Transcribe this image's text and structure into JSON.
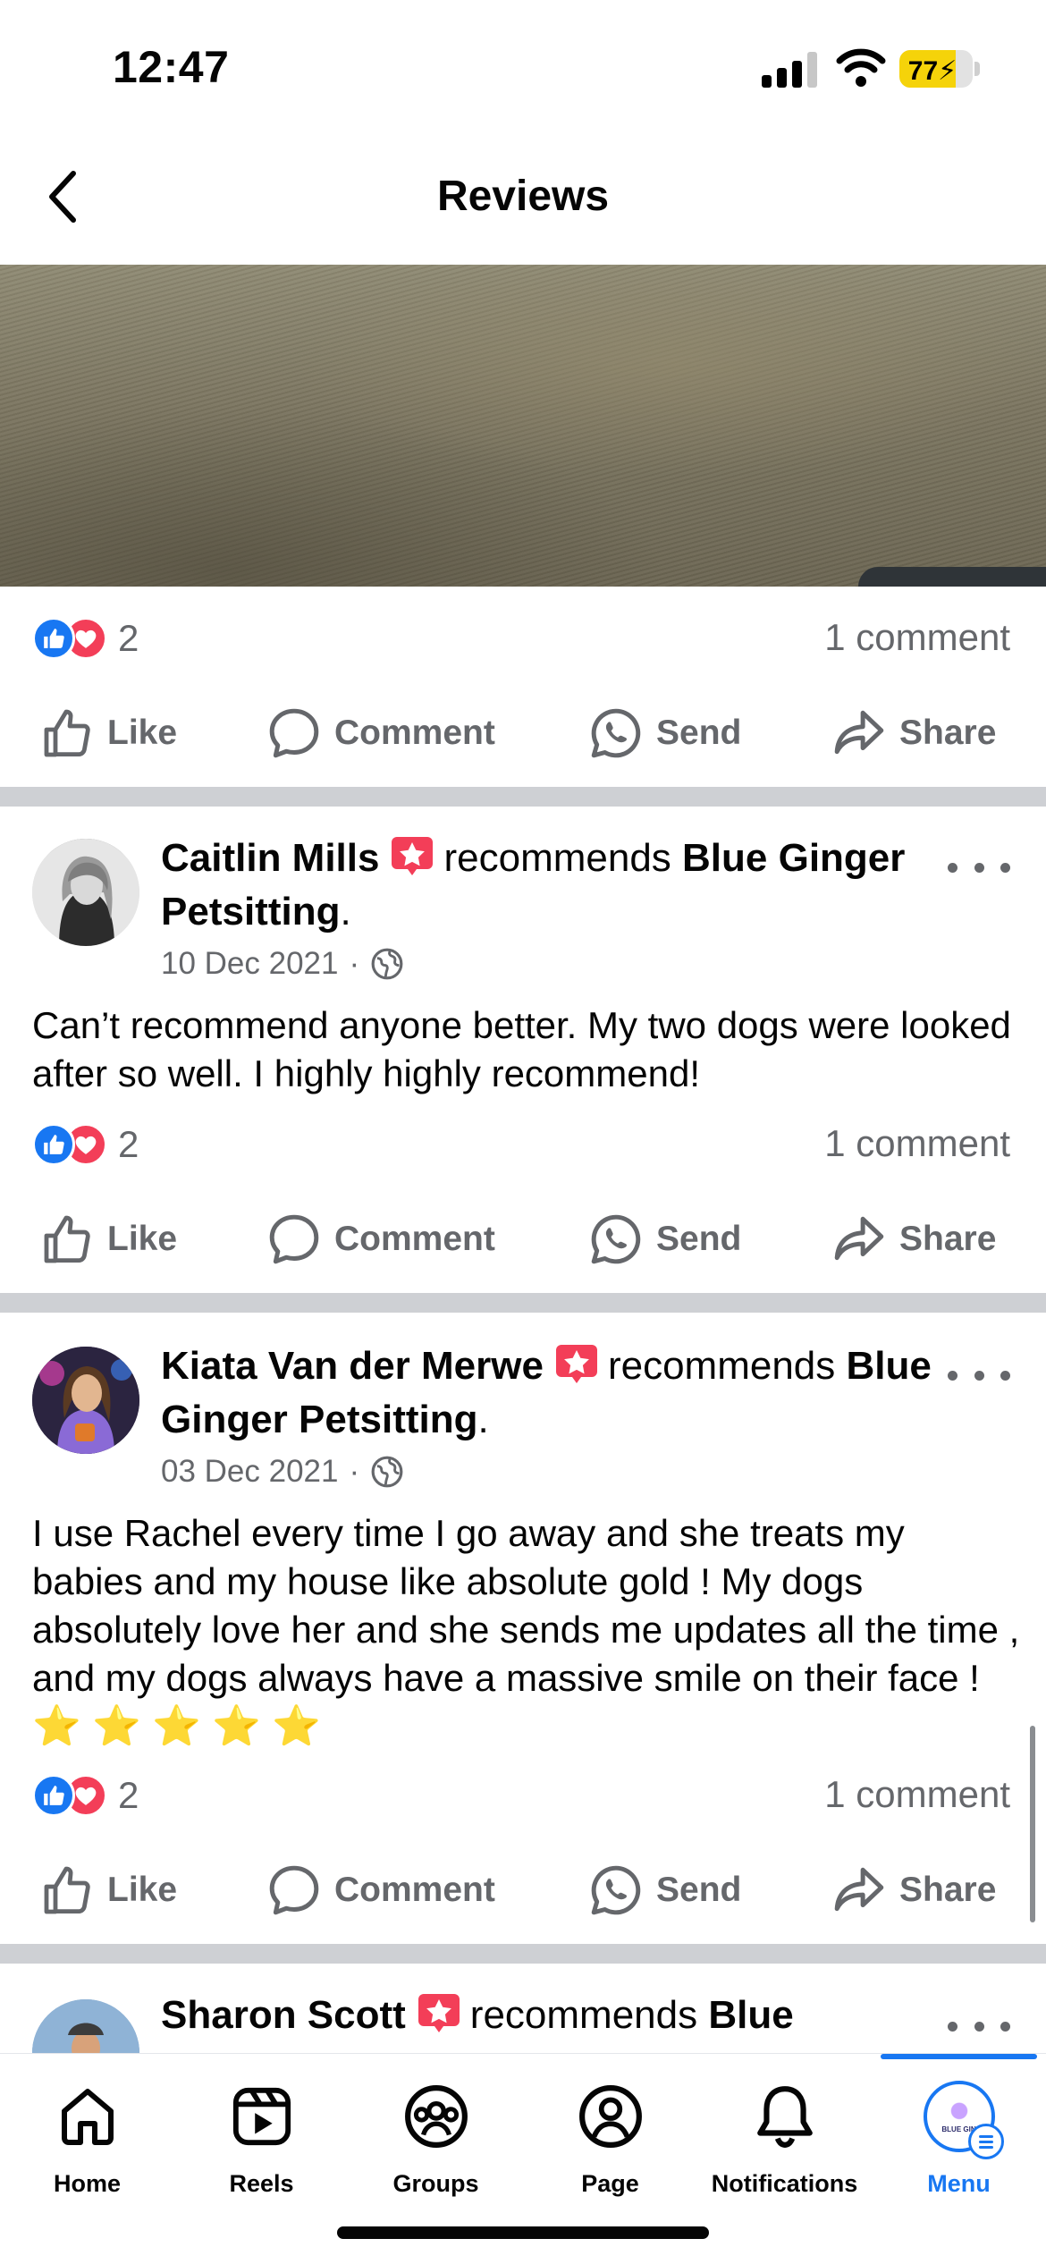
{
  "status_bar": {
    "time": "12:47",
    "battery": "77",
    "battery_level": 0.77
  },
  "header": {
    "title": "Reviews"
  },
  "post0": {
    "reaction_count": "2",
    "comment_count": "1 comment"
  },
  "actions": {
    "like": "Like",
    "comment": "Comment",
    "send": "Send",
    "share": "Share"
  },
  "reviews": [
    {
      "name": "Caitlin Mills",
      "recommends": "recommends",
      "business": "Blue Ginger Petsitting",
      "date": "10 Dec 2021",
      "text": "Can’t recommend anyone better. My two dogs were looked after so well. I highly highly recommend!",
      "reaction_count": "2",
      "comment_count": "1 comment"
    },
    {
      "name": "Kiata Van der Merwe",
      "recommends": "recommends",
      "business": "Blue Ginger Petsitting",
      "date": "03 Dec 2021",
      "text": "I use Rachel every time I go away and she treats my babies and my house like absolute gold ! My dogs absolutely love her and she sends me updates all the time , and my dogs always have a massive smile on their face !",
      "stars": "⭐ ⭐ ⭐ ⭐ ⭐",
      "reaction_count": "2",
      "comment_count": "1 comment"
    },
    {
      "name": "Sharon Scott",
      "recommends": "recommends",
      "business_partial": "Blue"
    }
  ],
  "nav": {
    "home": "Home",
    "reels": "Reels",
    "groups": "Groups",
    "page": "Page",
    "notifications": "Notifications",
    "menu": "Menu",
    "menu_avatar_text": "BLUE GIN"
  },
  "colors": {
    "accent": "#1877f2",
    "love": "#f33e58",
    "muted": "#65676b",
    "divider": "#ced0d4"
  }
}
